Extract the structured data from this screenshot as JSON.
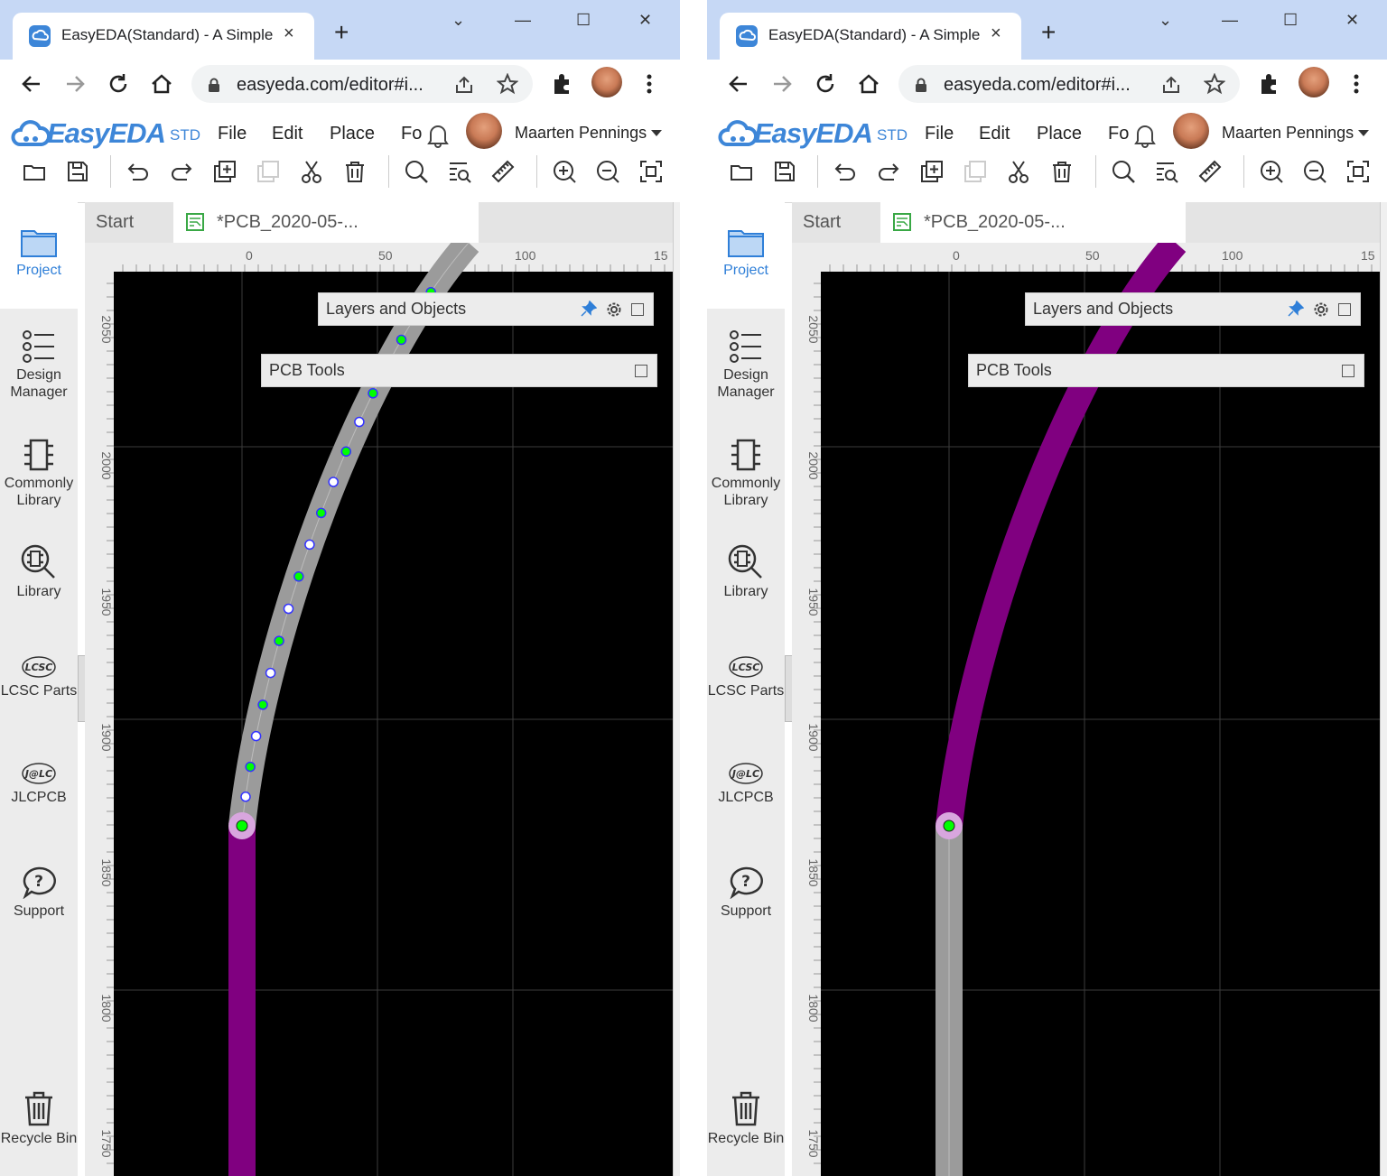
{
  "browser": {
    "tab_title": "EasyEDA(Standard) - A Simple",
    "tab_close": "×",
    "new_tab": "+",
    "url": "easyeda.com/editor#i...",
    "window_controls": [
      "⌄",
      "—",
      "☐",
      "✕"
    ]
  },
  "app": {
    "logo_text": "EasyEDA",
    "logo_suffix": "STD",
    "menu": [
      "File",
      "Edit",
      "Place",
      "Fo"
    ],
    "user_name": "Maarten Pennings",
    "toolbar_icons": [
      "open-folder-icon",
      "save-icon",
      "undo-icon",
      "redo-icon",
      "add-copy-icon",
      "paste-icon",
      "cut-icon",
      "delete-icon",
      "search-icon",
      "find-list-icon",
      "ruler-icon",
      "zoom-in-icon",
      "zoom-out-icon",
      "fit-icon"
    ]
  },
  "sidebar": {
    "items": [
      {
        "label": "Project",
        "icon": "folder-icon"
      },
      {
        "label": "Design Manager",
        "icon": "list-icon"
      },
      {
        "label": "Commonly Library",
        "icon": "chip-icon"
      },
      {
        "label": "Library",
        "icon": "library-search-icon"
      },
      {
        "label": "LCSC Parts",
        "icon": "lcsc-logo-icon"
      },
      {
        "label": "JLCPCB",
        "icon": "jlc-logo-icon"
      },
      {
        "label": "Support",
        "icon": "support-bubble-icon"
      },
      {
        "label": "Recycle Bin",
        "icon": "trash-icon"
      }
    ]
  },
  "editor": {
    "tabs": [
      "Start",
      "*PCB_2020-05-..."
    ],
    "ruler_top": [
      "0",
      "50",
      "100",
      "15"
    ],
    "ruler_left": [
      "2050",
      "2000",
      "1950",
      "1900",
      "1850",
      "1800",
      "1750"
    ],
    "panels": {
      "layers": "Layers and Objects",
      "pcb_tools": "PCB Tools"
    }
  },
  "colors": {
    "canvas": "#000000",
    "trace_top": "#800080",
    "trace_selected": "#9b9b9b",
    "grid": "#3c3c3c",
    "handle_green": "#00ff00",
    "handle_blue": "#3333ff",
    "accent": "#3d86d8"
  },
  "canvas_state": [
    {
      "view": "left",
      "selected_segment": "arc",
      "arc_handles": 20
    },
    {
      "view": "right",
      "selected_segment": "straight",
      "arc_handles": 0
    }
  ]
}
